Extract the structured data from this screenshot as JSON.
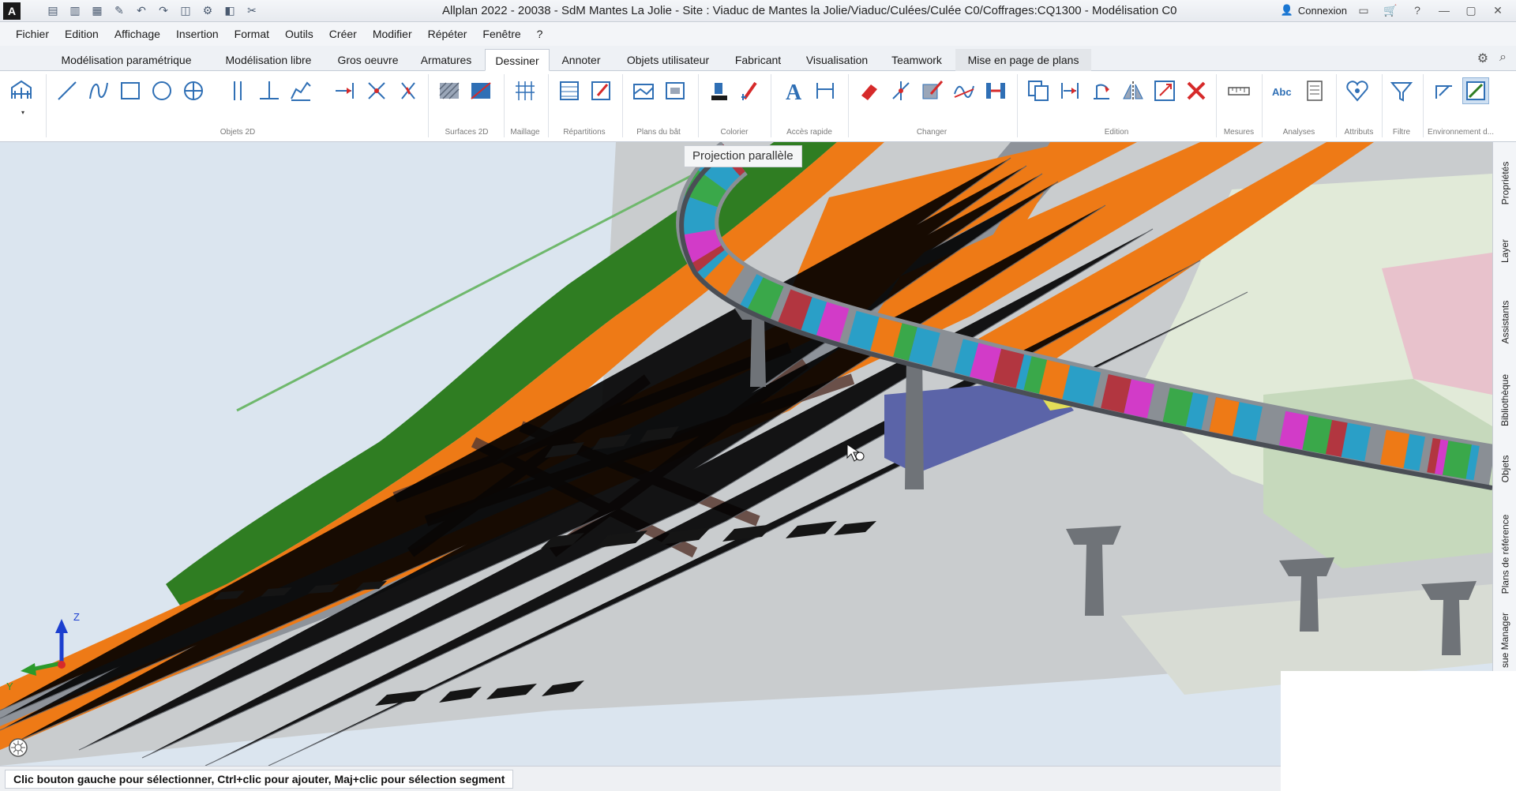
{
  "titlebar": {
    "app_logo": "A",
    "title": "Allplan 2022 - 20038 - SdM Mantes La Jolie - Site : Viaduc de Mantes la Jolie/Viaduc/Culées/Culée C0/Coffrages:CQ1300 - Modélisation C0",
    "connexion": "Connexion",
    "qat_icons": [
      "new-icon",
      "open-icon",
      "save-icon",
      "edit-icon",
      "undo-icon",
      "redo-icon",
      "window-icon",
      "settings-icon",
      "view-icon",
      "tools-icon"
    ]
  },
  "menu": [
    "Fichier",
    "Edition",
    "Affichage",
    "Insertion",
    "Format",
    "Outils",
    "Créer",
    "Modifier",
    "Répéter",
    "Fenêtre",
    "?"
  ],
  "ribbon_tabs": [
    {
      "label": "Modélisation paramétrique"
    },
    {
      "label": "Modélisation libre"
    },
    {
      "label": "Gros oeuvre"
    },
    {
      "label": "Armatures"
    },
    {
      "label": "Dessiner"
    },
    {
      "label": "Annoter"
    },
    {
      "label": "Objets utilisateur"
    },
    {
      "label": "Fabricant"
    },
    {
      "label": "Visualisation"
    },
    {
      "label": "Teamwork"
    },
    {
      "label": "Mise en page de plans"
    }
  ],
  "active_tab": "Dessiner",
  "ribbon_groups": [
    "Objets 2D",
    "Surfaces 2D",
    "Maillage",
    "Répartitions",
    "Plans du bât",
    "Colorier",
    "Accès rapide",
    "Changer",
    "Edition",
    "Mesures",
    "Analyses",
    "Attributs",
    "Filtre",
    "Environnement d..."
  ],
  "tooltip": "Projection parallèle",
  "side_tabs": [
    "Propriétés",
    "Layer",
    "Assistants",
    "Bibliothèque",
    "Objets",
    "Plans de référence",
    "sue Manager"
  ],
  "axes": {
    "z": "Z",
    "y": "Y"
  },
  "status": "Clic bouton gauche pour sélectionner, Ctrl+clic pour ajouter, Maj+clic pour sélection segment",
  "colors": {
    "accent": "#2f6fb5",
    "orange": "#ee7a16",
    "green": "#2f7d22",
    "sky": "#dbe5ef",
    "track_gray": "#8e939a",
    "pier_gray": "#6f7378",
    "magenta": "#d23bc8",
    "cyan": "#2a9fc7",
    "red_brown": "#b23640"
  }
}
